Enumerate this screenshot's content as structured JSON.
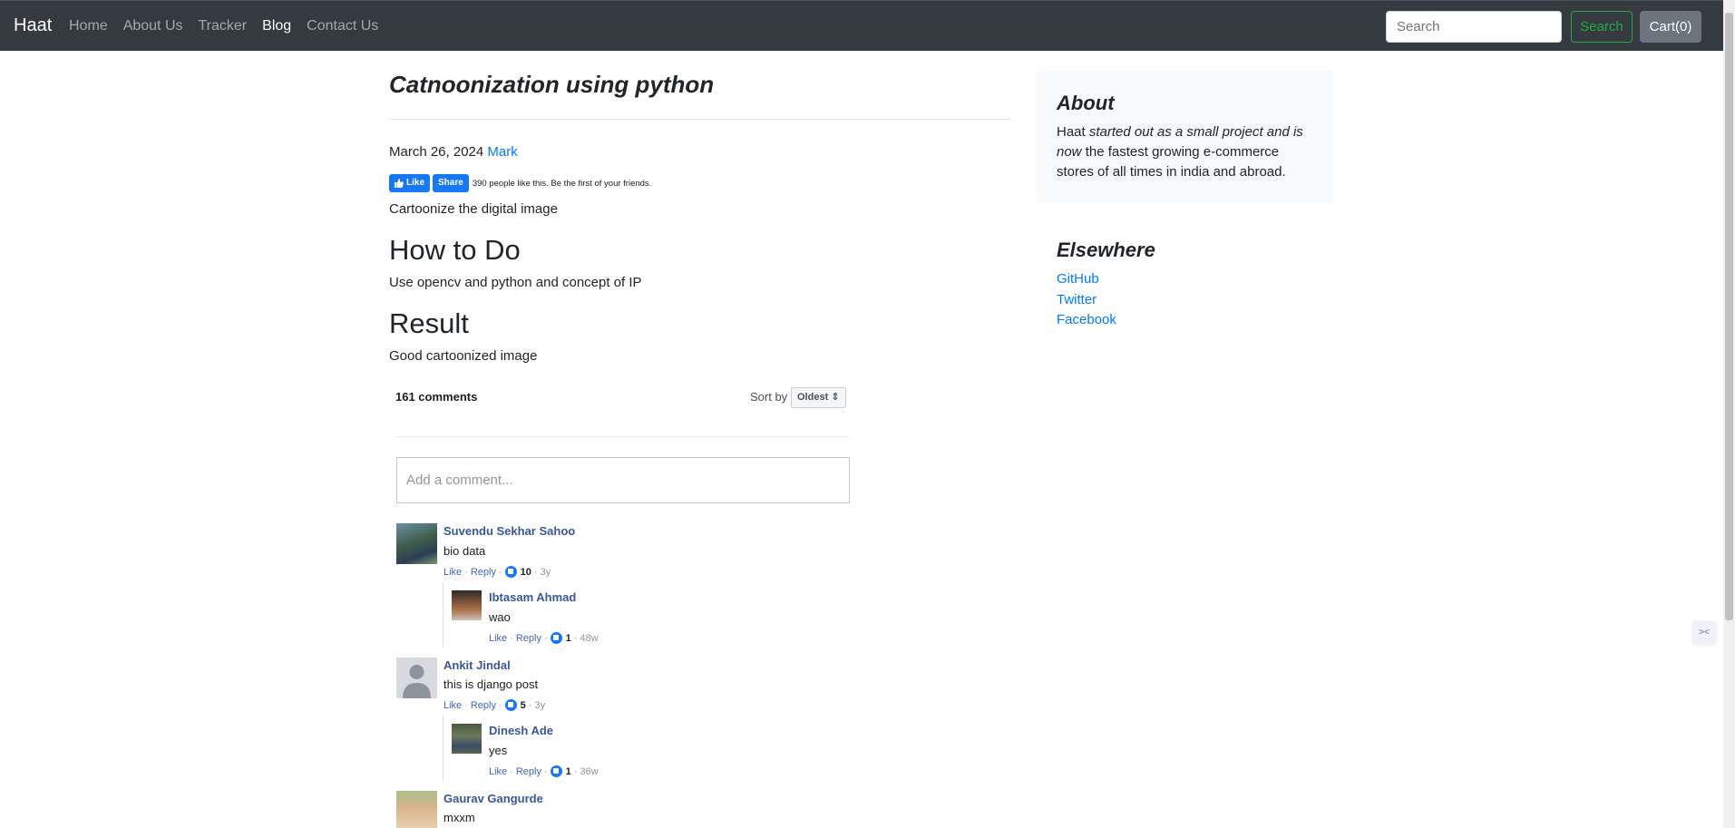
{
  "navbar": {
    "brand": "Haat",
    "links": [
      {
        "label": "Home"
      },
      {
        "label": "About Us"
      },
      {
        "label": "Tracker"
      },
      {
        "label": "Blog"
      },
      {
        "label": "Contact Us"
      }
    ],
    "active_link": "Blog",
    "search_placeholder": "Search",
    "search_button": "Search",
    "cart_button": "Cart(0)"
  },
  "post": {
    "title": "Catnoonization using python",
    "date": "March 26, 2024",
    "author": "Mark",
    "intro": "Cartoonize the digital image",
    "sections": [
      {
        "heading": "How to Do",
        "body": "Use opencv and python and concept of IP"
      },
      {
        "heading": "Result",
        "body": "Good cartoonized image"
      }
    ]
  },
  "fb_like": {
    "like_label": "Like",
    "share_label": "Share",
    "summary": "390 people like this. Be the first of your friends."
  },
  "comments": {
    "count_label": "161 comments",
    "sort_label": "Sort by",
    "sort_value": "Oldest",
    "input_placeholder": "Add a comment...",
    "like_label": "Like",
    "reply_label": "Reply",
    "items": [
      {
        "name": "Suvendu Sekhar Sahoo",
        "text": "bio data",
        "likes": "10",
        "age": "3y"
      },
      {
        "name": "Ibtasam Ahmad",
        "text": "wao",
        "likes": "1",
        "age": "48w"
      },
      {
        "name": "Ankit Jindal",
        "text": "this is django post",
        "likes": "5",
        "age": "3y"
      },
      {
        "name": "Dinesh Ade",
        "text": "yes",
        "likes": "1",
        "age": "36w"
      },
      {
        "name": "Gaurav Gangurde",
        "text": "mxxm"
      }
    ]
  },
  "sidebar": {
    "about_title": "About",
    "about_text_1": "Haat ",
    "about_text_em": "started out as a small project and is now",
    "about_text_2": " the fastest growing e-commerce stores of all times in india and abroad.",
    "elsewhere_title": "Elsewhere",
    "links": [
      {
        "label": "GitHub"
      },
      {
        "label": "Twitter"
      },
      {
        "label": "Facebook"
      }
    ]
  },
  "colors": {
    "navbar_bg": "#343a40",
    "link_blue": "#007bff",
    "fb_blue": "#1877f2",
    "fb_name": "#385898",
    "search_green": "#28a745"
  }
}
